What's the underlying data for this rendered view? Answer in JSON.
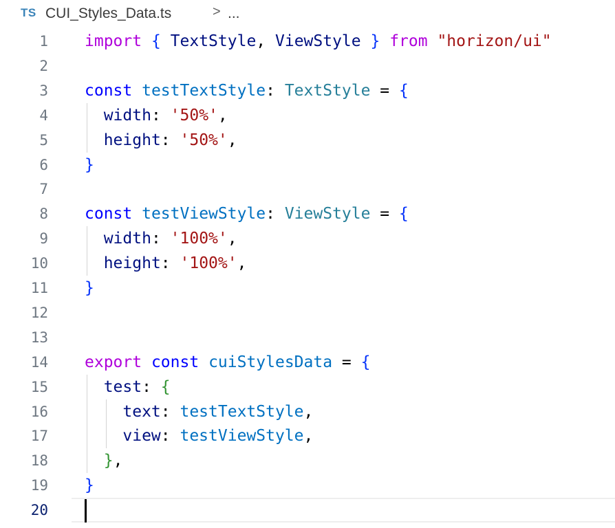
{
  "breadcrumb": {
    "language_badge": "TS",
    "file_name": "CUI_Styles_Data.ts",
    "separator": ">",
    "more": "..."
  },
  "editor": {
    "current_line": 20,
    "lines": [
      {
        "n": "1",
        "tokens": [
          {
            "t": "import",
            "c": "kw-import"
          },
          {
            "t": " ",
            "c": "punc"
          },
          {
            "t": "{",
            "c": "brace"
          },
          {
            "t": " ",
            "c": "punc"
          },
          {
            "t": "TextStyle",
            "c": "prop"
          },
          {
            "t": ", ",
            "c": "punc"
          },
          {
            "t": "ViewStyle",
            "c": "prop"
          },
          {
            "t": " ",
            "c": "punc"
          },
          {
            "t": "}",
            "c": "brace"
          },
          {
            "t": " ",
            "c": "punc"
          },
          {
            "t": "from",
            "c": "kw-import"
          },
          {
            "t": " ",
            "c": "punc"
          },
          {
            "t": "\"horizon/ui\"",
            "c": "str"
          }
        ]
      },
      {
        "n": "2",
        "tokens": []
      },
      {
        "n": "3",
        "tokens": [
          {
            "t": "const",
            "c": "kw"
          },
          {
            "t": " ",
            "c": "punc"
          },
          {
            "t": "testTextStyle",
            "c": "var"
          },
          {
            "t": ": ",
            "c": "punc"
          },
          {
            "t": "TextStyle",
            "c": "type"
          },
          {
            "t": " = ",
            "c": "punc"
          },
          {
            "t": "{",
            "c": "brace"
          }
        ]
      },
      {
        "n": "4",
        "guides": 1,
        "tokens": [
          {
            "t": "  ",
            "c": "punc"
          },
          {
            "t": "width",
            "c": "prop"
          },
          {
            "t": ": ",
            "c": "punc"
          },
          {
            "t": "'50%'",
            "c": "str"
          },
          {
            "t": ",",
            "c": "punc"
          }
        ]
      },
      {
        "n": "5",
        "guides": 1,
        "tokens": [
          {
            "t": "  ",
            "c": "punc"
          },
          {
            "t": "height",
            "c": "prop"
          },
          {
            "t": ": ",
            "c": "punc"
          },
          {
            "t": "'50%'",
            "c": "str"
          },
          {
            "t": ",",
            "c": "punc"
          }
        ]
      },
      {
        "n": "6",
        "tokens": [
          {
            "t": "}",
            "c": "brace"
          }
        ]
      },
      {
        "n": "7",
        "tokens": []
      },
      {
        "n": "8",
        "tokens": [
          {
            "t": "const",
            "c": "kw"
          },
          {
            "t": " ",
            "c": "punc"
          },
          {
            "t": "testViewStyle",
            "c": "var"
          },
          {
            "t": ": ",
            "c": "punc"
          },
          {
            "t": "ViewStyle",
            "c": "type"
          },
          {
            "t": " = ",
            "c": "punc"
          },
          {
            "t": "{",
            "c": "brace"
          }
        ]
      },
      {
        "n": "9",
        "guides": 1,
        "tokens": [
          {
            "t": "  ",
            "c": "punc"
          },
          {
            "t": "width",
            "c": "prop"
          },
          {
            "t": ": ",
            "c": "punc"
          },
          {
            "t": "'100%'",
            "c": "str"
          },
          {
            "t": ",",
            "c": "punc"
          }
        ]
      },
      {
        "n": "10",
        "guides": 1,
        "tokens": [
          {
            "t": "  ",
            "c": "punc"
          },
          {
            "t": "height",
            "c": "prop"
          },
          {
            "t": ": ",
            "c": "punc"
          },
          {
            "t": "'100%'",
            "c": "str"
          },
          {
            "t": ",",
            "c": "punc"
          }
        ]
      },
      {
        "n": "11",
        "tokens": [
          {
            "t": "}",
            "c": "brace"
          }
        ]
      },
      {
        "n": "12",
        "tokens": []
      },
      {
        "n": "13",
        "tokens": []
      },
      {
        "n": "14",
        "tokens": [
          {
            "t": "export",
            "c": "kw-import"
          },
          {
            "t": " ",
            "c": "punc"
          },
          {
            "t": "const",
            "c": "kw"
          },
          {
            "t": " ",
            "c": "punc"
          },
          {
            "t": "cuiStylesData",
            "c": "var"
          },
          {
            "t": " = ",
            "c": "punc"
          },
          {
            "t": "{",
            "c": "brace"
          }
        ]
      },
      {
        "n": "15",
        "guides": 1,
        "tokens": [
          {
            "t": "  ",
            "c": "punc"
          },
          {
            "t": "test",
            "c": "prop"
          },
          {
            "t": ": ",
            "c": "punc"
          },
          {
            "t": "{",
            "c": "brace2"
          }
        ]
      },
      {
        "n": "16",
        "guides": 2,
        "tokens": [
          {
            "t": "    ",
            "c": "punc"
          },
          {
            "t": "text",
            "c": "prop"
          },
          {
            "t": ": ",
            "c": "punc"
          },
          {
            "t": "testTextStyle",
            "c": "var"
          },
          {
            "t": ",",
            "c": "punc"
          }
        ]
      },
      {
        "n": "17",
        "guides": 2,
        "tokens": [
          {
            "t": "    ",
            "c": "punc"
          },
          {
            "t": "view",
            "c": "prop"
          },
          {
            "t": ": ",
            "c": "punc"
          },
          {
            "t": "testViewStyle",
            "c": "var"
          },
          {
            "t": ",",
            "c": "punc"
          }
        ]
      },
      {
        "n": "18",
        "guides": 1,
        "tokens": [
          {
            "t": "  ",
            "c": "punc"
          },
          {
            "t": "}",
            "c": "brace2"
          },
          {
            "t": ",",
            "c": "punc"
          }
        ]
      },
      {
        "n": "19",
        "tokens": [
          {
            "t": "}",
            "c": "brace"
          }
        ]
      },
      {
        "n": "20",
        "tokens": []
      }
    ]
  }
}
